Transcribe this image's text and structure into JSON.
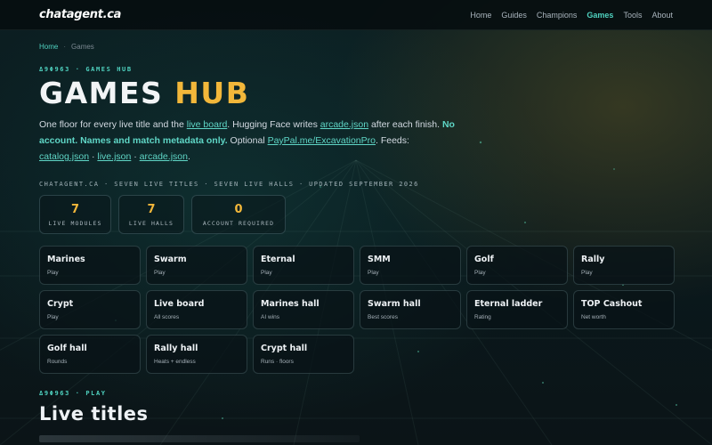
{
  "brand": {
    "logo": "chatagent.ca"
  },
  "nav": [
    {
      "label": "Home",
      "active": false
    },
    {
      "label": "Guides",
      "active": false
    },
    {
      "label": "Champions",
      "active": false
    },
    {
      "label": "Games",
      "active": true
    },
    {
      "label": "Tools",
      "active": false
    },
    {
      "label": "About",
      "active": false
    }
  ],
  "breadcrumb": {
    "home": "Home",
    "separator": "·",
    "current": "Games"
  },
  "hero": {
    "eyebrow": "Δ9Φ963 · GAMES HUB",
    "title_part1": "GAMES",
    "title_part2": "HUB",
    "lede": {
      "t1": "One floor for every live title and the ",
      "link_live_board": "live board",
      "t2": ". Hugging Face writes ",
      "link_arcade": "arcade.json",
      "t3": " after each finish. ",
      "bold": "No account. Names and match metadata only.",
      "t4": " Optional ",
      "link_paypal": "PayPal.me/ExcavationPro",
      "t5": ". Feeds: ",
      "feed1": "catalog.json",
      "dot1": " · ",
      "feed2": "live.json",
      "dot2": " · ",
      "feed3": "arcade.json",
      "end": "."
    },
    "meta": "CHATAGENT.CA · SEVEN LIVE TITLES · SEVEN LIVE HALLS · UPDATED SEPTEMBER 2026"
  },
  "stats": [
    {
      "value": "7",
      "label": "LIVE MODULES"
    },
    {
      "value": "7",
      "label": "LIVE HALLS"
    },
    {
      "value": "0",
      "label": "ACCOUNT REQUIRED"
    }
  ],
  "modules": [
    {
      "title": "Marines",
      "sub": "Play"
    },
    {
      "title": "Swarm",
      "sub": "Play"
    },
    {
      "title": "Eternal",
      "sub": "Play"
    },
    {
      "title": "SMM",
      "sub": "Play"
    },
    {
      "title": "Golf",
      "sub": "Play"
    },
    {
      "title": "Rally",
      "sub": "Play"
    },
    {
      "title": "Crypt",
      "sub": "Play"
    },
    {
      "title": "Live board",
      "sub": "All scores"
    },
    {
      "title": "Marines hall",
      "sub": "AI wins"
    },
    {
      "title": "Swarm hall",
      "sub": "Best scores"
    },
    {
      "title": "Eternal ladder",
      "sub": "Rating"
    },
    {
      "title": "TOP Cashout",
      "sub": "Net worth"
    },
    {
      "title": "Golf hall",
      "sub": "Rounds"
    },
    {
      "title": "Rally hall",
      "sub": "Heats + endless"
    },
    {
      "title": "Crypt hall",
      "sub": "Runs · floors"
    }
  ],
  "section": {
    "eyebrow": "Δ9Φ963 · PLAY",
    "title": "Live titles"
  },
  "colors": {
    "accent": "#4fd1bf",
    "gold": "#f2b73a",
    "bg": "#0b1a1d"
  }
}
